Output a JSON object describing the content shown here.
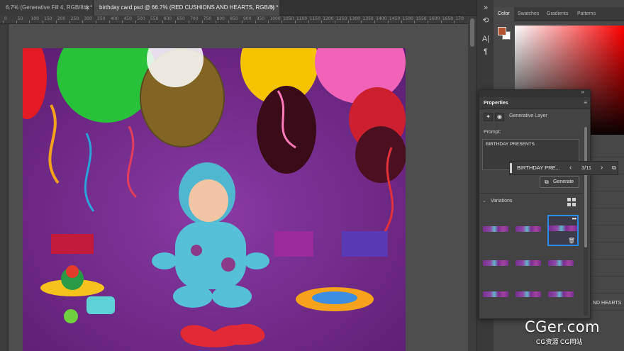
{
  "document_tabs": [
    {
      "label": "6.7% (Generative Fill 4, RGB/8#) *",
      "close": "✕"
    },
    {
      "label": "birthday card.psd @ 66.7% (RED CUSHIONS AND HEARTS, RGB/8) *",
      "close": "✕"
    }
  ],
  "ruler": {
    "ticks": [
      "0",
      "50",
      "100",
      "150",
      "200",
      "250",
      "300",
      "350",
      "400",
      "450",
      "500",
      "550",
      "600",
      "650",
      "700",
      "750",
      "800",
      "850",
      "900",
      "950",
      "1000",
      "1050",
      "1100",
      "1150",
      "1200",
      "1250",
      "1300",
      "1350",
      "1400",
      "1450",
      "1500",
      "1550",
      "1600",
      "1650",
      "170"
    ]
  },
  "color_panel": {
    "tabs": [
      "Color",
      "Swatches",
      "Gradients",
      "Patterns"
    ],
    "foreground": "#b4542f",
    "background": "#ffffff"
  },
  "properties_panel": {
    "title": "Properties",
    "layer_type": "Generative Layer",
    "prompt_label": "Prompt:",
    "prompt_value": "BIRTHDAY PRESENTS",
    "pager_label": "BIRTHDAY PRE...",
    "pager_count": "3/11",
    "generate_label": "Generate",
    "variations_label": "Variations",
    "more_label": "•••"
  },
  "layers_panel": {
    "visible_text": "ND HEARTS"
  },
  "watermark": {
    "main": "CGer.com",
    "sub": "CG资源 CG网站"
  },
  "colors": {
    "accent": "#2d8ceb",
    "canvas_background": "#7a2d92"
  },
  "icons": {
    "close": "close-icon",
    "prev": "chevron-left-icon",
    "next": "chevron-right-icon",
    "open": "external-link-icon",
    "delete": "trash-icon",
    "grid": "grid-view-icon"
  }
}
